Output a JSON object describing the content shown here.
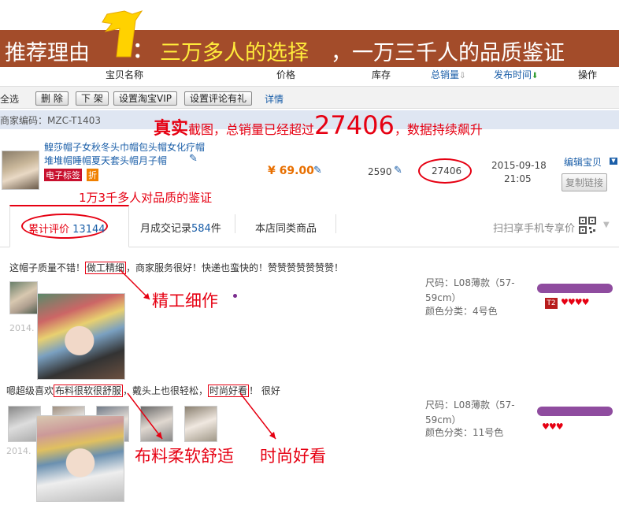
{
  "banner": {
    "title": "推荐理由",
    "colon": "：",
    "highlight": "三万多人的选择",
    "rest": "，一万三千人的品质鉴证"
  },
  "table_header": {
    "name": "宝贝名称",
    "price": "价格",
    "stock": "库存",
    "total_sales": "总销量",
    "publish_time": "发布时间",
    "actions": "操作"
  },
  "toolbar": {
    "select_all": "全选",
    "delete": "删 除",
    "offshelf": "下 架",
    "vip": "设置淘宝VIP",
    "comment": "设置评论有礼",
    "details": "详情"
  },
  "merchant_code": "商家编码：MZC-T1403",
  "annotation_top": {
    "bold": "真实",
    "text1": "截图，总销量已经超过",
    "number": "27406",
    "text2": "，数据持续飙升"
  },
  "product": {
    "title_line1": "鳇莎帽子女秋冬头巾帽包头帽女化疗帽",
    "title_line2": "堆堆帽睡帽夏天套头帽月子帽",
    "tag_label": "电子标签",
    "discount_label": "折",
    "price": "¥ 69.00",
    "stock": "2590",
    "sales": "27406",
    "publish_date": "2015-09-18",
    "publish_time": "21:05",
    "edit": "编辑宝贝",
    "copy": "复制链接"
  },
  "annotation_quality": "1万3千多人对品质的鉴证",
  "tabs": {
    "reviews_label": "累计评价",
    "reviews_count": "13144",
    "monthly_label": "月成交记录",
    "monthly_count": "584",
    "monthly_unit": "件",
    "same_shop": "本店同类商品",
    "scan": "扫扫享手机专享价"
  },
  "review1": {
    "text_a": "这帽子质量不错！",
    "text_boxed": "做工精细",
    "text_b": "，商家服务很好！快递也蛮快的！赞赞赞赞赞赞赞！",
    "date": "2014.",
    "size": "尺码：L08薄款（57-59cm）",
    "color": "颜色分类：4号色",
    "badge": "T2",
    "annotation": "精工细作"
  },
  "review2": {
    "text_a": "嗯超级喜欢",
    "text_boxed1": "布料很软很舒服",
    "text_b": "，戴头上也很轻松，",
    "text_boxed2": "时尚好看",
    "text_c": "！ 很好",
    "date": "2014.",
    "size": "尺码：L08薄款（57-59cm）",
    "color": "颜色分类：11号色",
    "annotation1": "布料柔软舒适",
    "annotation2": "时尚好看"
  },
  "colors": {
    "banner_bg": "#a34c2a",
    "accent_red": "#e60012",
    "link_blue": "#1a5ea8",
    "price_orange": "#e86f00"
  }
}
